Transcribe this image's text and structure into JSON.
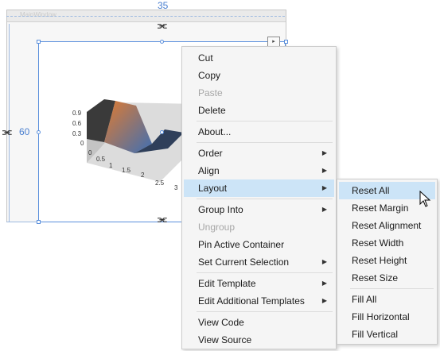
{
  "designer": {
    "window_title": "MainWindow",
    "top_margin": "35",
    "left_margin": "60",
    "collapse_button_glyph": "▸"
  },
  "chart": {
    "z_ticks": [
      "0.9",
      "0.6",
      "0.3",
      "0"
    ],
    "x_ticks": [
      "0",
      "0.5",
      "1",
      "1.5",
      "2",
      "2.5",
      "3"
    ],
    "colors": {
      "dark": "#2b2b2b",
      "orange": "#e07b30",
      "blue": "#3f6fb3",
      "floor": "#c8c8c8"
    }
  },
  "context_menu": {
    "items": [
      {
        "label": "Cut",
        "enabled": true,
        "submenu": false
      },
      {
        "label": "Copy",
        "enabled": true,
        "submenu": false
      },
      {
        "label": "Paste",
        "enabled": false,
        "submenu": false
      },
      {
        "label": "Delete",
        "enabled": true,
        "submenu": false
      },
      {
        "label": "About...",
        "enabled": true,
        "submenu": false
      },
      {
        "label": "Order",
        "enabled": true,
        "submenu": true
      },
      {
        "label": "Align",
        "enabled": true,
        "submenu": true
      },
      {
        "label": "Layout",
        "enabled": true,
        "submenu": true,
        "highlighted": true
      },
      {
        "label": "Group Into",
        "enabled": true,
        "submenu": true
      },
      {
        "label": "Ungroup",
        "enabled": false,
        "submenu": false
      },
      {
        "label": "Pin Active Container",
        "enabled": true,
        "submenu": false
      },
      {
        "label": "Set Current Selection",
        "enabled": true,
        "submenu": true
      },
      {
        "label": "Edit Template",
        "enabled": true,
        "submenu": true
      },
      {
        "label": "Edit Additional Templates",
        "enabled": true,
        "submenu": true
      },
      {
        "label": "View Code",
        "enabled": true,
        "submenu": false
      },
      {
        "label": "View Source",
        "enabled": true,
        "submenu": false
      }
    ]
  },
  "layout_submenu": {
    "items": [
      {
        "label": "Reset All",
        "highlighted": true
      },
      {
        "label": "Reset Margin"
      },
      {
        "label": "Reset Alignment"
      },
      {
        "label": "Reset Width"
      },
      {
        "label": "Reset Height"
      },
      {
        "label": "Reset Size"
      },
      {
        "label": "Fill All"
      },
      {
        "label": "Fill Horizontal"
      },
      {
        "label": "Fill Vertical"
      }
    ]
  },
  "theme": {
    "menu_bg": "#f5f5f5",
    "highlight": "#cce4f7",
    "disabled_text": "#a6a6a6",
    "selection_blue": "#5a8fdc"
  }
}
